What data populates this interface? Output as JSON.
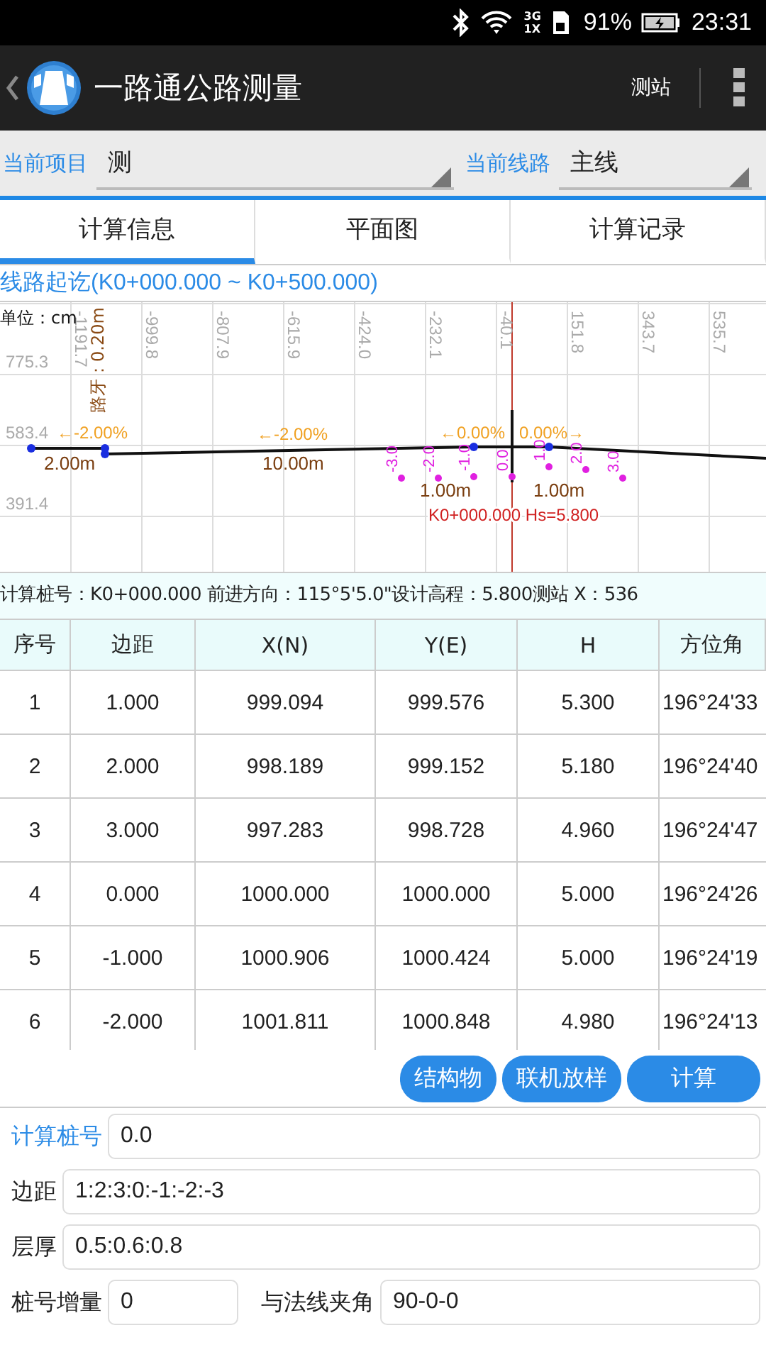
{
  "status_bar": {
    "network_types": [
      "3G",
      "1X"
    ],
    "battery": "91%",
    "time": "23:31"
  },
  "app_bar": {
    "title": "一路通公路测量",
    "action": "测站"
  },
  "selectors": [
    {
      "label": "当前项目",
      "value": "测"
    },
    {
      "label": "当前线路",
      "value": "主线"
    }
  ],
  "tabs": [
    {
      "label": "计算信息",
      "selected": true
    },
    {
      "label": "平面图",
      "selected": false
    },
    {
      "label": "计算记录",
      "selected": false
    }
  ],
  "route_range": "线路起讫(K0+000.000 ~ K0+500.000)",
  "profile": {
    "unit": "单位：cm",
    "curb": "路牙：0.20m",
    "x_ticks": [
      "-1191.7",
      "-999.8",
      "-807.9",
      "-615.9",
      "-424.0",
      "-232.1",
      "-40.1",
      "151.8",
      "343.7",
      "535.7"
    ],
    "y_ticks": [
      "775.3",
      "583.4",
      "391.4"
    ],
    "slopes": [
      "←-2.00%",
      "←-2.00%",
      "←0.00%",
      "0.00%→"
    ],
    "widths": [
      "2.00m",
      "10.00m",
      "1.00m",
      "1.00m"
    ],
    "offsets": [
      "-3.0",
      "-2.0",
      "-1.0",
      "0.0",
      "1.0",
      "2.0",
      "3.0"
    ],
    "station_label": "K0+000.000 Hs=5.800"
  },
  "info_line": "计算桩号：K0+000.000 前进方向：115°5'5.0\"设计高程：5.800测站  X：536",
  "table": {
    "columns": [
      "序号",
      "边距",
      "X(N)",
      "Y(E)",
      "H",
      "方位角"
    ],
    "rows": [
      [
        "1",
        "1.000",
        "999.094",
        "999.576",
        "5.300",
        "196°24'33"
      ],
      [
        "2",
        "2.000",
        "998.189",
        "999.152",
        "5.180",
        "196°24'40"
      ],
      [
        "3",
        "3.000",
        "997.283",
        "998.728",
        "4.960",
        "196°24'47"
      ],
      [
        "4",
        "0.000",
        "1000.000",
        "1000.000",
        "5.000",
        "196°24'26"
      ],
      [
        "5",
        "-1.000",
        "1000.906",
        "1000.424",
        "5.000",
        "196°24'19"
      ],
      [
        "6",
        "-2.000",
        "1001.811",
        "1000.848",
        "4.980",
        "196°24'13"
      ]
    ]
  },
  "buttons": [
    "结构物",
    "联机放样",
    "计算"
  ],
  "form": [
    {
      "label": "计算桩号",
      "value": "0.0",
      "color": "#2b8be6"
    },
    {
      "label": "边距",
      "value": "1:2:3:0:-1:-2:-3",
      "color": "#222222"
    },
    {
      "label": "层厚",
      "value": "0.5:0.6:0.8",
      "color": "#222222"
    }
  ],
  "form_pair": [
    {
      "label": "桩号增量",
      "value": "0"
    },
    {
      "label": "与法线夹角",
      "value": "90-0-0"
    }
  ]
}
